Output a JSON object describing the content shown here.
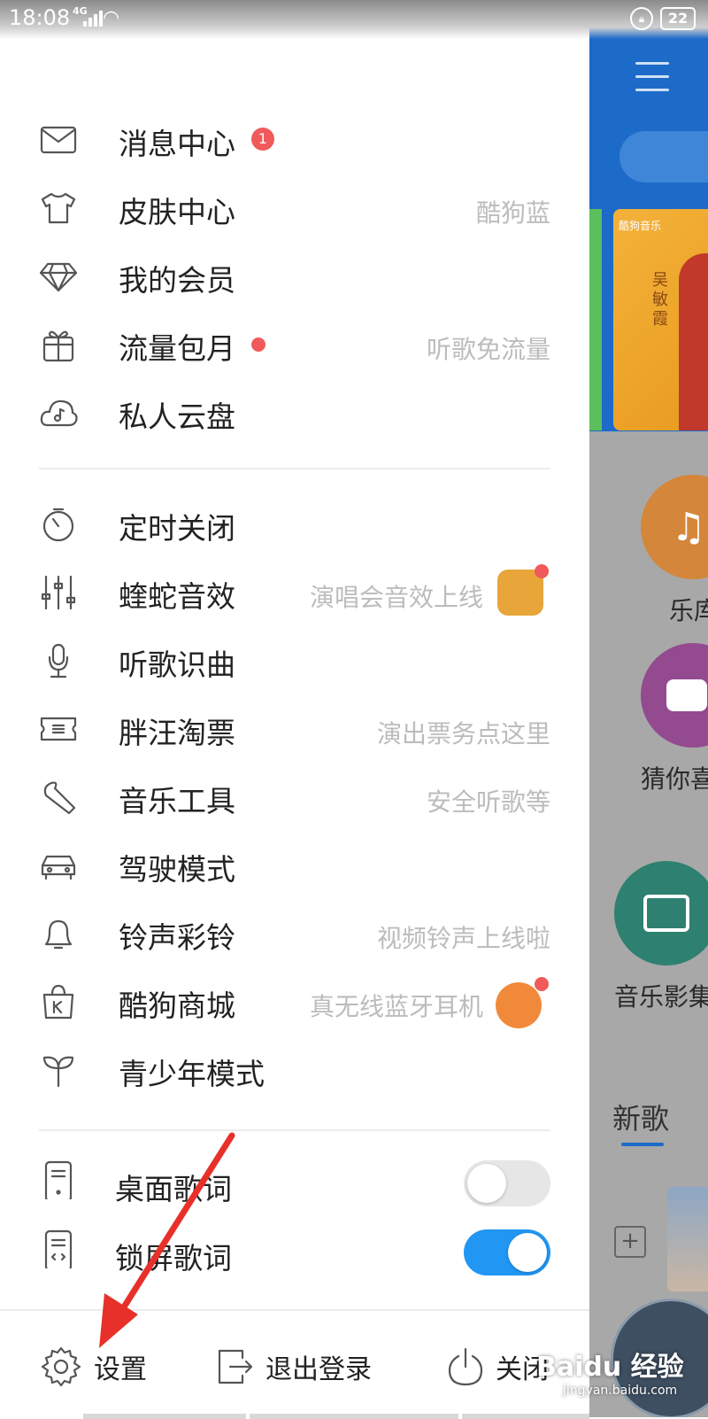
{
  "status_bar": {
    "time": "18:08",
    "network": "4G",
    "battery": "22"
  },
  "drawer": {
    "menu_group1": [
      {
        "label": "消息中心",
        "badge": "1"
      },
      {
        "label": "皮肤中心",
        "right": "酷狗蓝"
      },
      {
        "label": "我的会员"
      },
      {
        "label": "流量包月",
        "right": "听歌免流量"
      },
      {
        "label": "私人云盘"
      }
    ],
    "menu_group2": [
      {
        "label": "定时关闭"
      },
      {
        "label": "蝰蛇音效",
        "right": "演唱会音效上线"
      },
      {
        "label": "听歌识曲"
      },
      {
        "label": "胖汪淘票",
        "right": "演出票务点这里"
      },
      {
        "label": "音乐工具",
        "right": "安全听歌等"
      },
      {
        "label": "驾驶模式"
      },
      {
        "label": "铃声彩铃",
        "right": "视频铃声上线啦"
      },
      {
        "label": "酷狗商城",
        "right": "真无线蓝牙耳机"
      },
      {
        "label": "青少年模式"
      }
    ],
    "toggles": [
      {
        "label": "桌面歌词",
        "state": "off"
      },
      {
        "label": "锁屏歌词",
        "state": "on"
      }
    ],
    "bottom_bar": {
      "settings": "设置",
      "logout": "退出登录",
      "close": "关闭"
    }
  },
  "background_app": {
    "banner_brand": "酷狗音乐",
    "banner_name": "吴敏霞",
    "shortcut1": "乐库",
    "shortcut2": "猜你喜",
    "shortcut3": "音乐影集",
    "section_title": "新歌"
  },
  "watermark": {
    "brand": "Baidu 经验",
    "url": "jingyan.baidu.com"
  },
  "colors": {
    "accent_blue": "#2196f3",
    "badge_red": "#f05a5a",
    "app_blue": "#1c6bc9",
    "annotation_red": "#e8302a"
  }
}
